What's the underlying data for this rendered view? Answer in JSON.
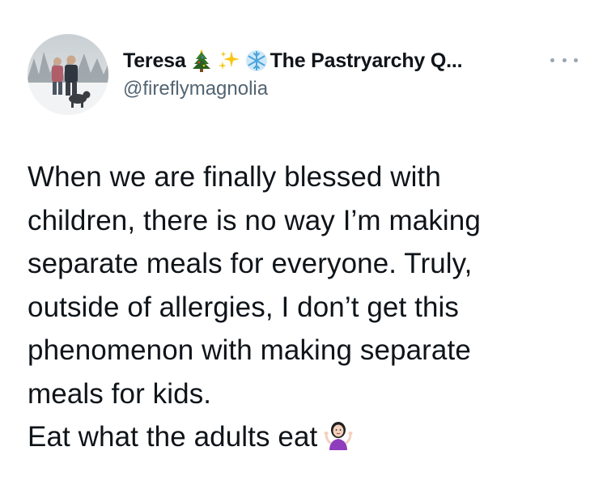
{
  "author": {
    "display_name": "Teresa",
    "display_name_suffix": "The Pastryarchy Q...",
    "handle": "@fireflymagnolia",
    "name_emojis": [
      "christmas-tree-icon",
      "sparkles-icon",
      "snowflake-icon"
    ]
  },
  "tweet": {
    "lines": [
      "When we are finally blessed with",
      "children, there is no way I’m making",
      "separate meals for everyone. Truly,",
      "outside of allergies, I don’t get this",
      "phenomenon with making separate",
      "meals for kids.",
      "Eat what the adults eat"
    ],
    "trailing_emoji": "person-shrugging-icon"
  },
  "colors": {
    "text_primary": "#0f1419",
    "text_secondary": "#536471",
    "background": "#ffffff"
  }
}
